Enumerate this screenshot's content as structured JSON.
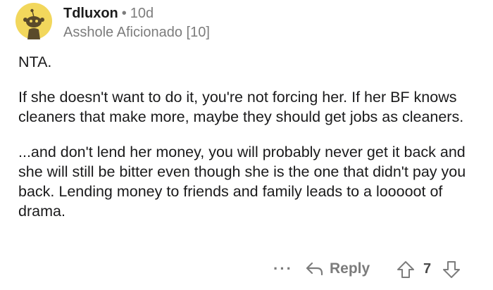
{
  "comment": {
    "author": "Tdluxon",
    "separator": "•",
    "age": "10d",
    "flair": "Asshole Aficionado [10]",
    "avatar_icon": "snoo-avatar-icon",
    "paragraphs": [
      "NTA.",
      "If she doesn't want to do it, you're not forcing her.  If her BF knows cleaners that make more, maybe they should get jobs as cleaners.",
      "...and don't lend her money, you will probably never get it back and she will still be bitter even though she is the one that didn't pay you back.  Lending money to friends and family leads to a looooot of drama."
    ]
  },
  "actions": {
    "more_label": "···",
    "reply_label": "Reply",
    "reply_icon": "reply-arrow-icon",
    "upvote_icon": "upvote-arrow-icon",
    "score": "7",
    "downvote_icon": "downvote-arrow-icon"
  },
  "colors": {
    "avatar_bg": "#f2d75c",
    "text": "#1a1a1b",
    "meta": "#7c7c7c"
  }
}
